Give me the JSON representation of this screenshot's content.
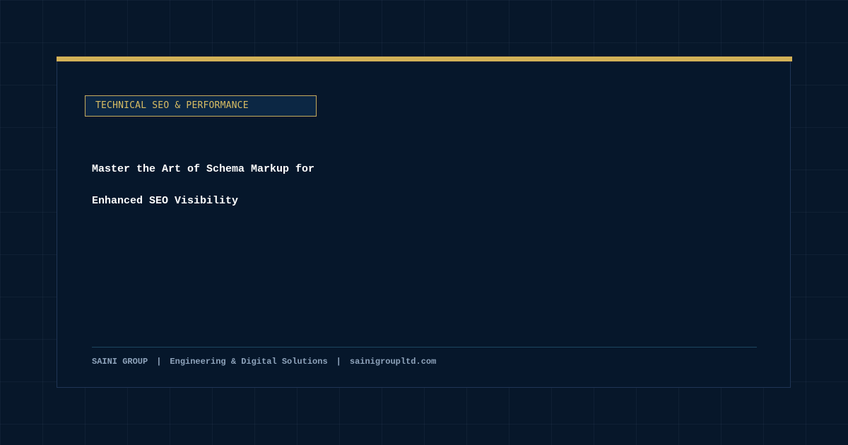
{
  "category": {
    "label": "TECHNICAL SEO & PERFORMANCE"
  },
  "headline": {
    "line1": "Master the Art of Schema Markup for",
    "line2": "Enhanced SEO Visibility"
  },
  "footer": {
    "company": "SAINI GROUP",
    "separator": "|",
    "tagline": "Engineering & Digital Solutions",
    "website": "sainigroupltd.com"
  },
  "colors": {
    "background": "#07172a",
    "accent_gold": "#d2b157",
    "headline_text": "#ffffff",
    "footer_text": "#8ea3bb"
  }
}
